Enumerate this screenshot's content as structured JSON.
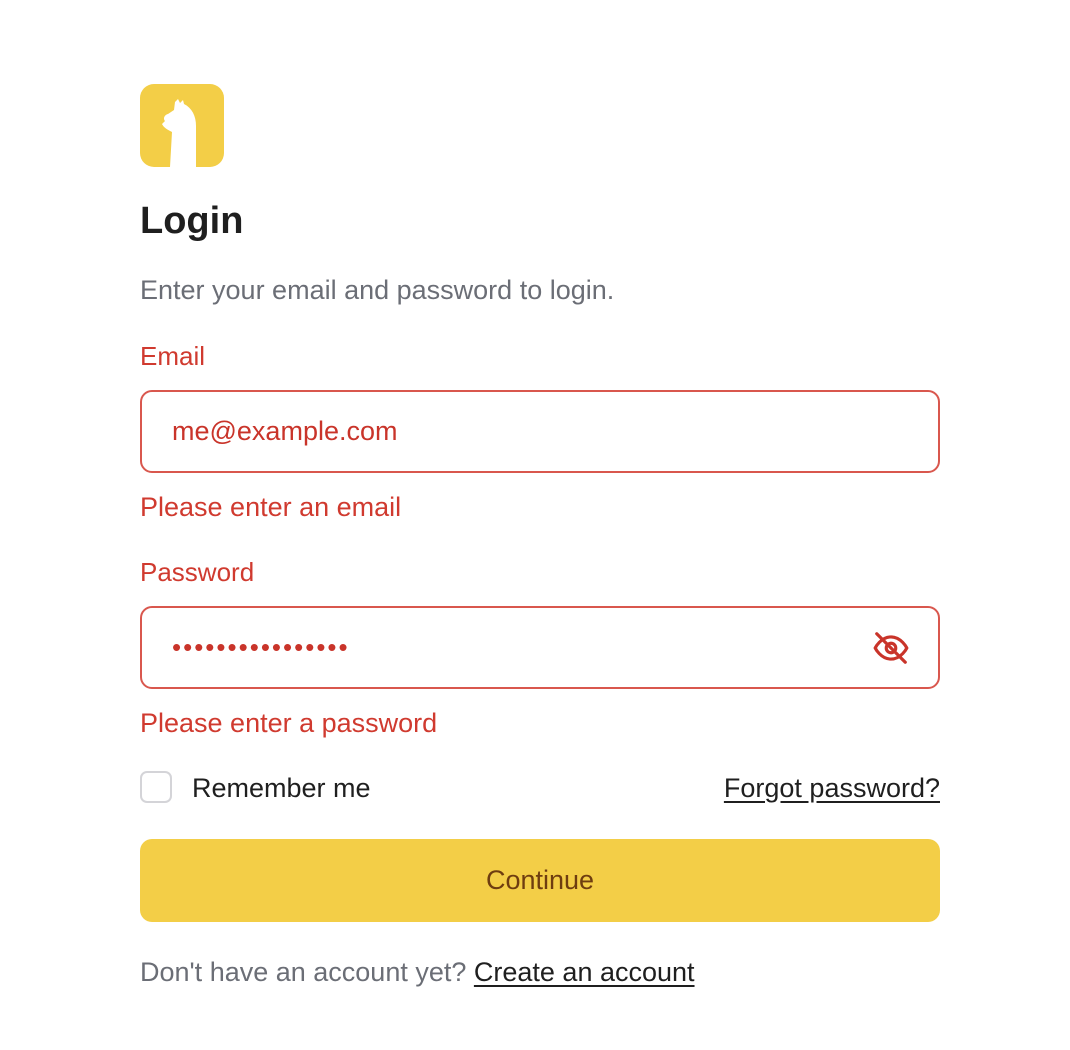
{
  "brand": {
    "logo_icon": "llama-icon",
    "accent_color": "#f3ce47"
  },
  "header": {
    "title": "Login",
    "subtitle": "Enter your email and password to login."
  },
  "form": {
    "email": {
      "label": "Email",
      "value": "me@example.com",
      "error": "Please enter an email"
    },
    "password": {
      "label": "Password",
      "value": "••••••••••••••••",
      "error": "Please enter a password",
      "toggle_icon": "eye-off-icon"
    },
    "remember": {
      "label": "Remember me",
      "checked": false
    },
    "forgot_label": "Forgot password?",
    "submit_label": "Continue"
  },
  "footer": {
    "prompt": "Don't have an account yet?",
    "link_label": "Create an account"
  },
  "colors": {
    "error": "#d03a2f",
    "muted": "#6b6e76",
    "button_text": "#6e3d10"
  }
}
